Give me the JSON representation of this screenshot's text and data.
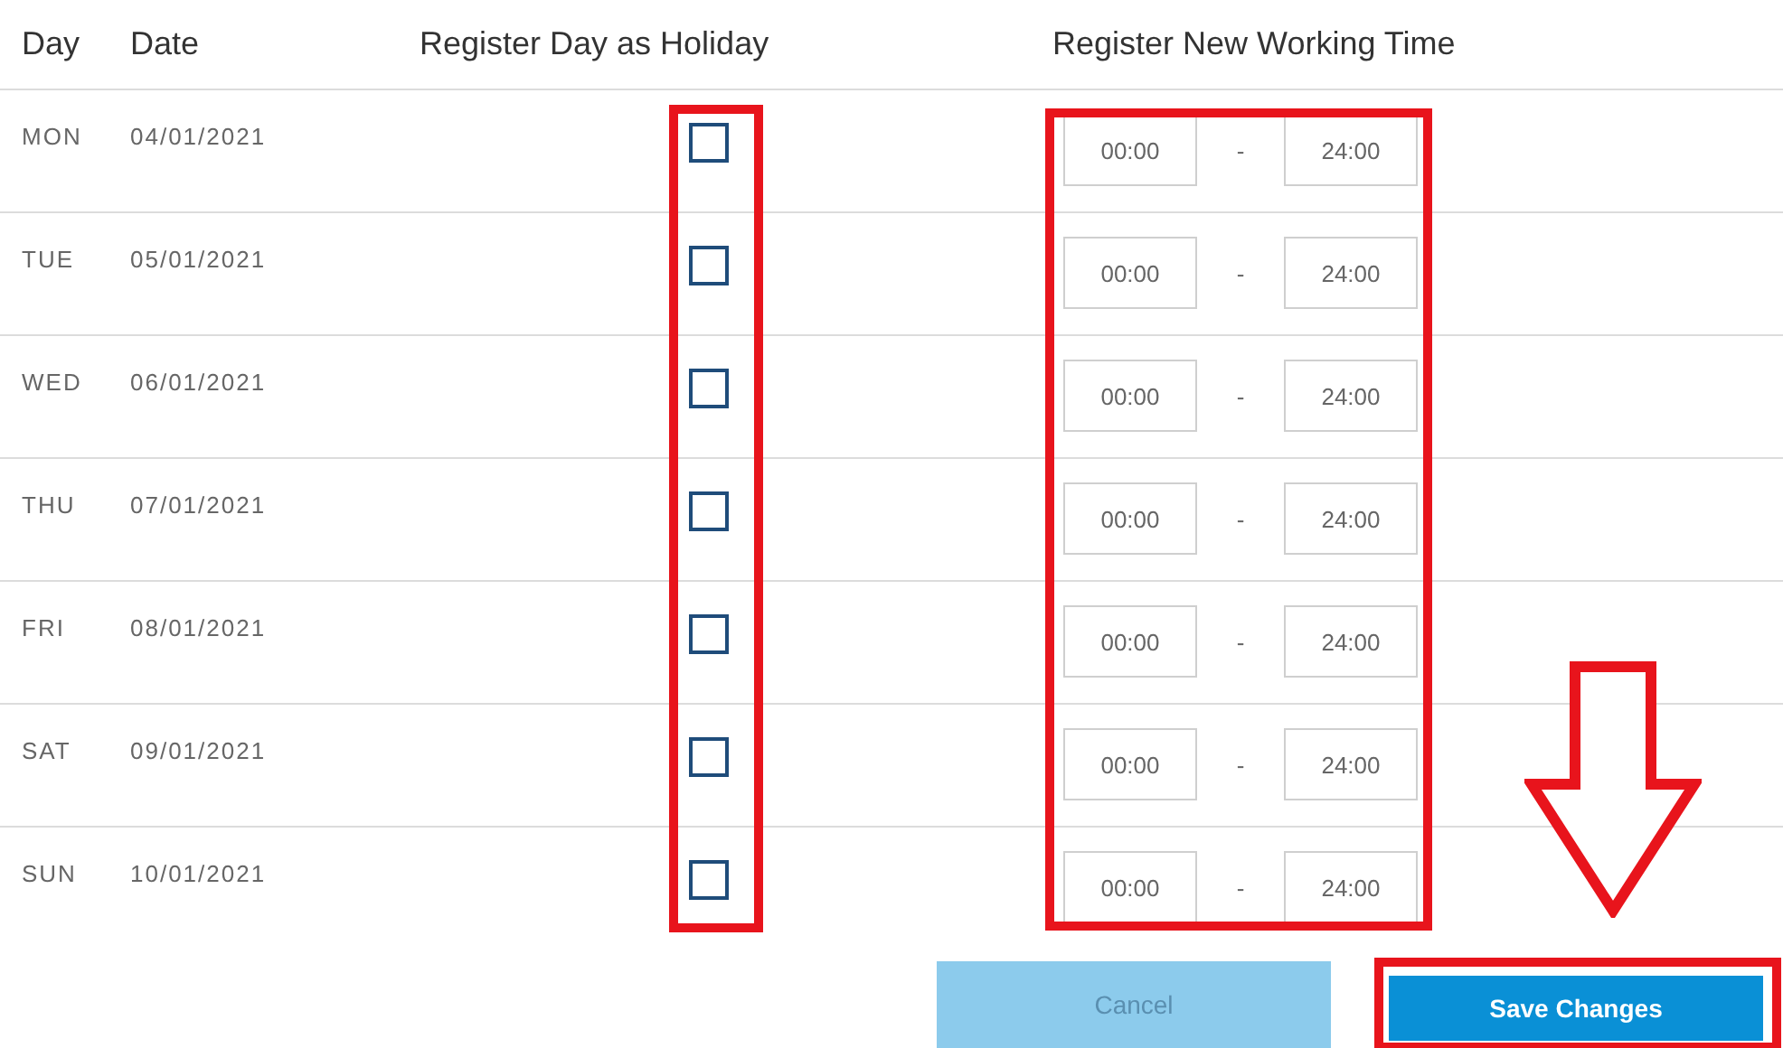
{
  "columns": [
    "Day",
    "Date",
    "Register Day as Holiday",
    "Register New Working Time"
  ],
  "rows": [
    {
      "day": "MON",
      "date": "04/01/2021",
      "holiday": false,
      "from": "00:00",
      "separator": "-",
      "to": "24:00"
    },
    {
      "day": "TUE",
      "date": "05/01/2021",
      "holiday": false,
      "from": "00:00",
      "separator": "-",
      "to": "24:00"
    },
    {
      "day": "WED",
      "date": "06/01/2021",
      "holiday": false,
      "from": "00:00",
      "separator": "-",
      "to": "24:00"
    },
    {
      "day": "THU",
      "date": "07/01/2021",
      "holiday": false,
      "from": "00:00",
      "separator": "-",
      "to": "24:00"
    },
    {
      "day": "FRI",
      "date": "08/01/2021",
      "holiday": false,
      "from": "00:00",
      "separator": "-",
      "to": "24:00"
    },
    {
      "day": "SAT",
      "date": "09/01/2021",
      "holiday": false,
      "from": "00:00",
      "separator": "-",
      "to": "24:00"
    },
    {
      "day": "SUN",
      "date": "10/01/2021",
      "holiday": false,
      "from": "00:00",
      "separator": "-",
      "to": "24:00"
    }
  ],
  "buttons": [
    {
      "label": "Cancel",
      "kind": "secondary"
    },
    {
      "label": "Save Changes",
      "kind": "primary"
    }
  ]
}
